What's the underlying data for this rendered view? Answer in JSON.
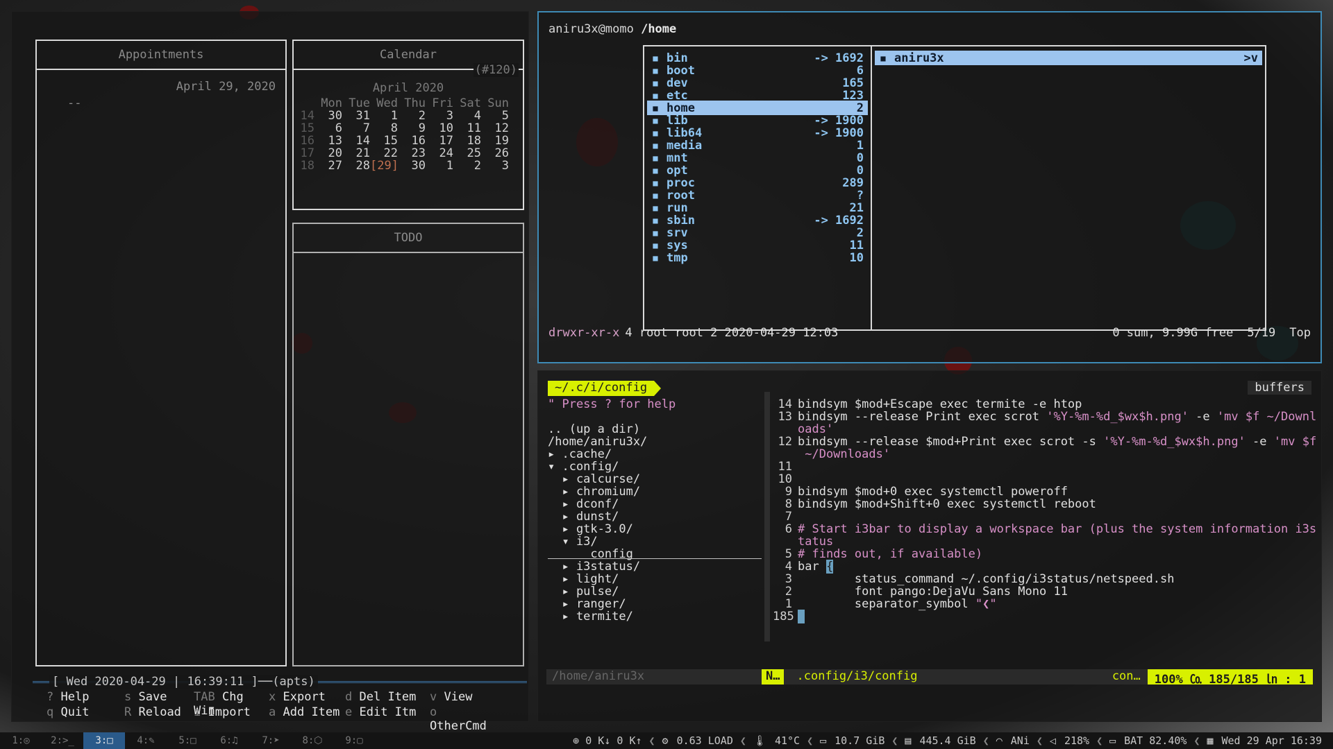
{
  "calcurse": {
    "appointments_title": "Appointments",
    "calendar_title": "Calendar",
    "todo_title": "TODO",
    "date_label": "April 29, 2020",
    "empty_marker": "--",
    "day_tag": "(#120)",
    "month_title": "April 2020",
    "weekdays": [
      "Mon",
      "Tue",
      "Wed",
      "Thu",
      "Fri",
      "Sat",
      "Sun"
    ],
    "weeks": [
      {
        "wk": "14",
        "days": [
          "30",
          "31",
          "1",
          "2",
          "3",
          "4",
          "5"
        ]
      },
      {
        "wk": "15",
        "days": [
          "6",
          "7",
          "8",
          "9",
          "10",
          "11",
          "12"
        ]
      },
      {
        "wk": "16",
        "days": [
          "13",
          "14",
          "15",
          "16",
          "17",
          "18",
          "19"
        ]
      },
      {
        "wk": "17",
        "days": [
          "20",
          "21",
          "22",
          "23",
          "24",
          "25",
          "26"
        ]
      },
      {
        "wk": "18",
        "days": [
          "27",
          "28",
          "[29]",
          "30",
          "1",
          "2",
          "3"
        ]
      }
    ],
    "status_line": "[ Wed 2020-04-29 | 16:39:11 ]──(apts)",
    "keys_row1": [
      {
        "key": "?",
        "label": "Help"
      },
      {
        "key": "s",
        "label": "Save"
      },
      {
        "key": "TAB",
        "label": "Chg Win"
      },
      {
        "key": "x",
        "label": "Export"
      },
      {
        "key": "d",
        "label": "Del Item"
      },
      {
        "key": "v",
        "label": "View"
      }
    ],
    "keys_row2": [
      {
        "key": "q",
        "label": "Quit"
      },
      {
        "key": "R",
        "label": "Reload"
      },
      {
        "key": "i",
        "label": "Import"
      },
      {
        "key": "a",
        "label": "Add Item"
      },
      {
        "key": "e",
        "label": "Edit Itm"
      },
      {
        "key": "o",
        "label": "OtherCmd"
      }
    ]
  },
  "ranger": {
    "user_host": "aniru3x@momo",
    "path": "/home",
    "entries": [
      {
        "name": "bin",
        "size": "-> 1692"
      },
      {
        "name": "boot",
        "size": "6"
      },
      {
        "name": "dev",
        "size": "165"
      },
      {
        "name": "etc",
        "size": "123"
      },
      {
        "name": "home",
        "size": "2",
        "selected": true
      },
      {
        "name": "lib",
        "size": "-> 1900"
      },
      {
        "name": "lib64",
        "size": "-> 1900"
      },
      {
        "name": "media",
        "size": "1"
      },
      {
        "name": "mnt",
        "size": "0"
      },
      {
        "name": "opt",
        "size": "0"
      },
      {
        "name": "proc",
        "size": "289"
      },
      {
        "name": "root",
        "size": "?"
      },
      {
        "name": "run",
        "size": "21"
      },
      {
        "name": "sbin",
        "size": "-> 1692"
      },
      {
        "name": "srv",
        "size": "2"
      },
      {
        "name": "sys",
        "size": "11"
      },
      {
        "name": "tmp",
        "size": "10"
      }
    ],
    "preview_entry": {
      "name": "aniru3x",
      "size": ">v"
    },
    "footer_perm": "drwxr-xr-x",
    "footer_info": "4 root root 2 2020-04-29 12:03",
    "footer_free": "0 sum, 9.99G free",
    "footer_pos": "5/19",
    "footer_top": "Top"
  },
  "vim": {
    "tree_title": "~/.c/i/config",
    "buffers_label": "buffers",
    "tree_lines": [
      {
        "text": "\" Press ? for help",
        "cls": "help"
      },
      {
        "text": "",
        "cls": ""
      },
      {
        "text": ".. (up a dir)",
        "cls": ""
      },
      {
        "text": "/home/aniru3x/",
        "cls": ""
      },
      {
        "text": "▸ .cache/",
        "cls": ""
      },
      {
        "text": "▾ .config/",
        "cls": ""
      },
      {
        "text": "  ▸ calcurse/",
        "cls": ""
      },
      {
        "text": "  ▸ chromium/",
        "cls": ""
      },
      {
        "text": "  ▸ dconf/",
        "cls": ""
      },
      {
        "text": "  ▸ dunst/",
        "cls": ""
      },
      {
        "text": "  ▸ gtk-3.0/",
        "cls": ""
      },
      {
        "text": "  ▾ i3/",
        "cls": ""
      },
      {
        "text": "      config",
        "cls": ""
      },
      {
        "text": "  ▸ i3status/",
        "cls": ""
      },
      {
        "text": "  ▸ light/",
        "cls": ""
      },
      {
        "text": "  ▸ pulse/",
        "cls": ""
      },
      {
        "text": "  ▸ ranger/",
        "cls": ""
      },
      {
        "text": "  ▸ termite/",
        "cls": ""
      }
    ],
    "code_lines": [
      {
        "ln": "14",
        "parts": [
          {
            "t": "bindsym $mod+Escape exec termite -e htop"
          }
        ]
      },
      {
        "ln": "13",
        "parts": [
          {
            "t": "bindsym --release Print exec scrot "
          },
          {
            "t": "'%Y-%m-%d_$wx$h.png'",
            "c": "str"
          },
          {
            "t": " -e "
          },
          {
            "t": "'mv $f ~/Downl",
            "c": "str"
          }
        ]
      },
      {
        "ln": "",
        "parts": [
          {
            "t": "oads'",
            "c": "str"
          }
        ]
      },
      {
        "ln": "12",
        "parts": [
          {
            "t": "bindsym --release $mod+Print exec scrot -s "
          },
          {
            "t": "'%Y-%m-%d_$wx$h.png'",
            "c": "str"
          },
          {
            "t": " -e "
          },
          {
            "t": "'mv $f",
            "c": "str"
          }
        ]
      },
      {
        "ln": "",
        "parts": [
          {
            "t": " ~/Downloads'",
            "c": "str"
          }
        ]
      },
      {
        "ln": "11",
        "parts": [
          {
            "t": ""
          }
        ]
      },
      {
        "ln": "10",
        "parts": [
          {
            "t": ""
          }
        ]
      },
      {
        "ln": "9",
        "parts": [
          {
            "t": "bindsym $mod+0 exec systemctl poweroff"
          }
        ]
      },
      {
        "ln": "8",
        "parts": [
          {
            "t": "bindsym $mod+Shift+0 exec systemctl reboot"
          }
        ]
      },
      {
        "ln": "7",
        "parts": [
          {
            "t": ""
          }
        ]
      },
      {
        "ln": "6",
        "parts": [
          {
            "t": "# Start i3bar to display a workspace bar (plus the system information i3s",
            "c": "cmt"
          }
        ]
      },
      {
        "ln": "",
        "parts": [
          {
            "t": "tatus",
            "c": "cmt"
          }
        ]
      },
      {
        "ln": "5",
        "parts": [
          {
            "t": "# finds out, if available)",
            "c": "cmt"
          }
        ]
      },
      {
        "ln": "4",
        "parts": [
          {
            "t": "bar "
          },
          {
            "t": "{",
            "c": "cursor"
          }
        ]
      },
      {
        "ln": "3",
        "parts": [
          {
            "t": "        status_command ~/.config/i3status/netspeed.sh"
          }
        ]
      },
      {
        "ln": "2",
        "parts": [
          {
            "t": "        font pango:DejaVu Sans Mono 11"
          }
        ]
      },
      {
        "ln": "1",
        "parts": [
          {
            "t": "        separator_symbol "
          },
          {
            "t": "\"❮\"",
            "c": "str"
          }
        ]
      },
      {
        "ln": "185",
        "parts": [
          {
            "t": " ",
            "c": "cursor"
          }
        ]
      }
    ],
    "status_path": "/home/aniru3x",
    "status_mode": "N…",
    "status_file": ".config/i3/config",
    "status_con": "con…",
    "status_pos": "100% ㏇ 185/185 ㏑ :  1"
  },
  "bar": {
    "workspaces": [
      {
        "label": "1:◎",
        "active": false
      },
      {
        "label": "2:>_",
        "active": false
      },
      {
        "label": "3:□",
        "active": true
      },
      {
        "label": "4:✎",
        "active": false
      },
      {
        "label": "5:□",
        "active": false
      },
      {
        "label": "6:♫",
        "active": false
      },
      {
        "label": "7:➤",
        "active": false
      },
      {
        "label": "8:⬡",
        "active": false
      },
      {
        "label": "9:▢",
        "active": false
      }
    ],
    "net": "⊕ 0 K↓ 0 K↑",
    "load": "0.63 LOAD",
    "temp": "41°C",
    "mem": "10.7 GiB",
    "disk": "445.4 GiB",
    "wifi": "ANi",
    "vol": "218%",
    "bat": "BAT 82.40%",
    "clock": "Wed 29 Apr 16:39"
  }
}
